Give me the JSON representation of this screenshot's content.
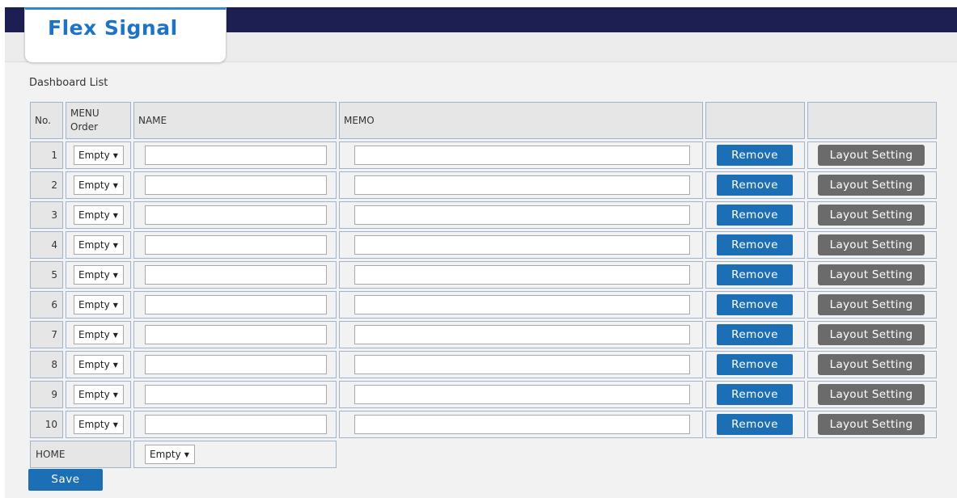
{
  "brand": {
    "name": "Flex Signal",
    "logo_bar_colors": [
      "#e53935",
      "#fbc02d",
      "#43a047",
      "#1e88e5"
    ]
  },
  "page": {
    "section_title": "Dashboard List"
  },
  "table": {
    "headers": {
      "no": "No.",
      "menu_order": "MENU\nOrder",
      "name": "NAME",
      "memo": "MEMO",
      "actions1": "",
      "actions2": ""
    },
    "rows": [
      {
        "no": "1",
        "menu_order": "Empty",
        "name": "",
        "memo": ""
      },
      {
        "no": "2",
        "menu_order": "Empty",
        "name": "",
        "memo": ""
      },
      {
        "no": "3",
        "menu_order": "Empty",
        "name": "",
        "memo": ""
      },
      {
        "no": "4",
        "menu_order": "Empty",
        "name": "",
        "memo": ""
      },
      {
        "no": "5",
        "menu_order": "Empty",
        "name": "",
        "memo": ""
      },
      {
        "no": "6",
        "menu_order": "Empty",
        "name": "",
        "memo": ""
      },
      {
        "no": "7",
        "menu_order": "Empty",
        "name": "",
        "memo": ""
      },
      {
        "no": "8",
        "menu_order": "Empty",
        "name": "",
        "memo": ""
      },
      {
        "no": "9",
        "menu_order": "Empty",
        "name": "",
        "memo": ""
      },
      {
        "no": "10",
        "menu_order": "Empty",
        "name": "",
        "memo": ""
      }
    ],
    "remove_label": "Remove",
    "layout_label": "Layout Setting",
    "home": {
      "label": "HOME",
      "value": "Empty"
    }
  },
  "actions": {
    "save_label": "Save"
  },
  "colors": {
    "topbar": "#1d1f52",
    "primary_button": "#1d6fb5",
    "secondary_button": "#6b6b6b",
    "brand_text": "#1c73c8"
  }
}
